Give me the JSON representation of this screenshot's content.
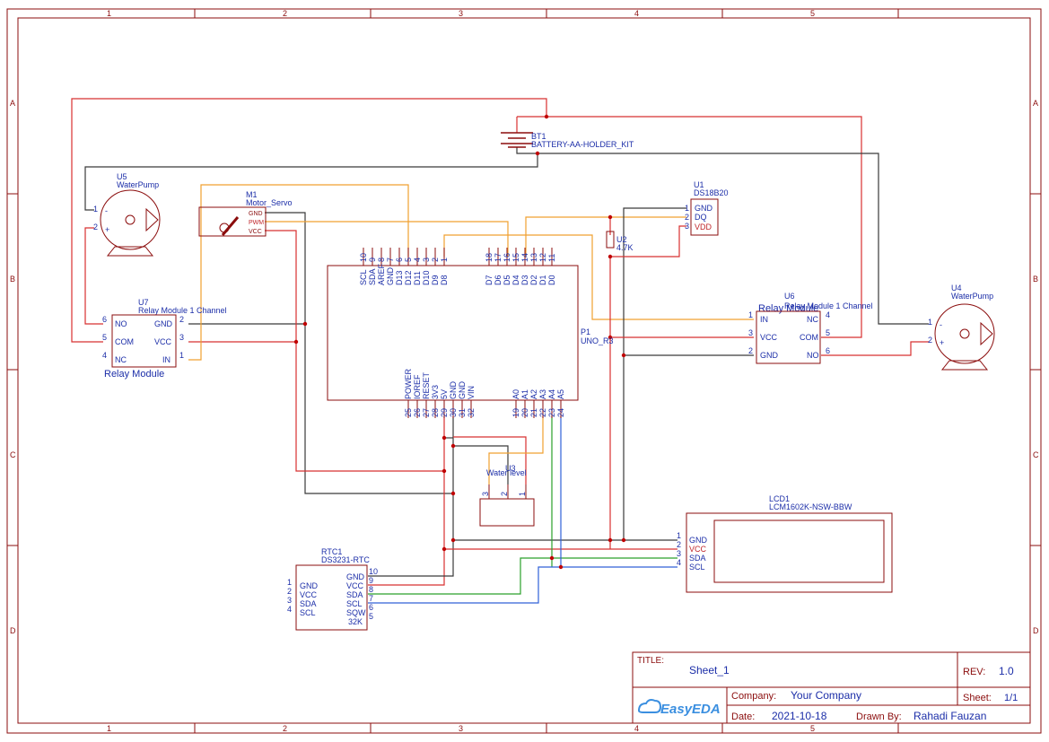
{
  "frame": {
    "col_numbers": [
      "1",
      "2",
      "3",
      "4",
      "5"
    ],
    "row_letters": [
      "A",
      "B",
      "C",
      "D"
    ]
  },
  "title_block": {
    "title_label": "TITLE:",
    "title_value": "Sheet_1",
    "rev_label": "REV:",
    "rev_value": "1.0",
    "company_label": "Company:",
    "company_value": "Your Company",
    "sheet_label": "Sheet:",
    "sheet_value": "1/1",
    "date_label": "Date:",
    "date_value": "2021-10-18",
    "drawn_label": "Drawn By:",
    "drawn_value": "Rahadi Fauzan",
    "logo_text": "EasyEDA"
  },
  "components": {
    "bt1": {
      "ref": "BT1",
      "name": "BATTERY-AA-HOLDER_KIT"
    },
    "u5": {
      "ref": "U5",
      "name": "WaterPump",
      "pin1": "1",
      "pin2": "2",
      "minus": "-",
      "plus": "+"
    },
    "u4": {
      "ref": "U4",
      "name": "WaterPump",
      "pin1": "1",
      "pin2": "2",
      "minus": "-",
      "plus": "+"
    },
    "m1": {
      "ref": "M1",
      "name": "Motor_Servo",
      "gnd": "GND",
      "pwm": "PWM",
      "vcc": "VCC"
    },
    "u1": {
      "ref": "U1",
      "name": "DS18B20",
      "pins": [
        {
          "num": "1",
          "label": "GND"
        },
        {
          "num": "2",
          "label": "DQ"
        },
        {
          "num": "3",
          "label": "VDD"
        }
      ]
    },
    "u2": {
      "ref": "U2",
      "value": "4.7K"
    },
    "u7": {
      "ref": "U7",
      "name": "Relay Module 1 Channel",
      "caption": "Relay Module",
      "left": [
        {
          "num": "6",
          "label": "NO"
        },
        {
          "num": "5",
          "label": "COM"
        },
        {
          "num": "4",
          "label": "NC"
        }
      ],
      "right": [
        {
          "num": "2",
          "label": "GND"
        },
        {
          "num": "3",
          "label": "VCC"
        },
        {
          "num": "1",
          "label": "IN"
        }
      ]
    },
    "u6": {
      "ref": "U6",
      "name": "Relay Module 1 Channel",
      "caption": "Relay Module",
      "left": [
        {
          "num": "1",
          "label": "IN"
        },
        {
          "num": "3",
          "label": "VCC"
        },
        {
          "num": "2",
          "label": "GND"
        }
      ],
      "right": [
        {
          "num": "4",
          "label": "NC"
        },
        {
          "num": "5",
          "label": "COM"
        },
        {
          "num": "6",
          "label": "NO"
        }
      ]
    },
    "p1": {
      "ref": "P1",
      "name": "UNO_R3",
      "top_left": [
        {
          "num": "10",
          "label": "SCL"
        },
        {
          "num": "9",
          "label": "SDA"
        },
        {
          "num": "8",
          "label": "AREF"
        },
        {
          "num": "7",
          "label": "GND"
        },
        {
          "num": "6",
          "label": "D13"
        },
        {
          "num": "5",
          "label": "D12"
        },
        {
          "num": "4",
          "label": "D11"
        },
        {
          "num": "3",
          "label": "D10"
        },
        {
          "num": "2",
          "label": "D9"
        },
        {
          "num": "1",
          "label": "D8"
        }
      ],
      "top_right": [
        {
          "num": "18",
          "label": "D7"
        },
        {
          "num": "17",
          "label": "D6"
        },
        {
          "num": "16",
          "label": "D5"
        },
        {
          "num": "15",
          "label": "D4"
        },
        {
          "num": "14",
          "label": "D3"
        },
        {
          "num": "13",
          "label": "D2"
        },
        {
          "num": "12",
          "label": "D1"
        },
        {
          "num": "11",
          "label": "D0"
        }
      ],
      "bottom_left": [
        {
          "num": "25",
          "label": "POWER"
        },
        {
          "num": "26",
          "label": "IOREF"
        },
        {
          "num": "27",
          "label": "RESET"
        },
        {
          "num": "28",
          "label": "3V3"
        },
        {
          "num": "29",
          "label": "5V"
        },
        {
          "num": "30",
          "label": "GND"
        },
        {
          "num": "31",
          "label": "GND"
        },
        {
          "num": "32",
          "label": "VIN"
        }
      ],
      "bottom_right": [
        {
          "num": "19",
          "label": "A0"
        },
        {
          "num": "20",
          "label": "A1"
        },
        {
          "num": "21",
          "label": "A2"
        },
        {
          "num": "22",
          "label": "A3"
        },
        {
          "num": "23",
          "label": "A4"
        },
        {
          "num": "24",
          "label": "A5"
        }
      ]
    },
    "u3": {
      "ref": "U3",
      "name": "Water level",
      "pins": [
        "3",
        "2",
        "1"
      ]
    },
    "lcd1": {
      "ref": "LCD1",
      "name": "LCM1602K-NSW-BBW",
      "pins": [
        {
          "num": "1",
          "label": "GND"
        },
        {
          "num": "2",
          "label": "VCC"
        },
        {
          "num": "3",
          "label": "SDA"
        },
        {
          "num": "4",
          "label": "SCL"
        }
      ]
    },
    "rtc1": {
      "ref": "RTC1",
      "name": "DS3231-RTC",
      "left": [
        {
          "num": "1",
          "label": "GND"
        },
        {
          "num": "2",
          "label": "VCC"
        },
        {
          "num": "3",
          "label": "SDA"
        },
        {
          "num": "4",
          "label": "SCL"
        }
      ],
      "right": [
        {
          "num": "10",
          "label": "GND"
        },
        {
          "num": "9",
          "label": "VCC"
        },
        {
          "num": "8",
          "label": "SDA"
        },
        {
          "num": "7",
          "label": "SCL"
        },
        {
          "num": "6",
          "label": "SQW"
        },
        {
          "num": "5",
          "label": "32K"
        }
      ]
    }
  },
  "colors": {
    "frame": "#8b0d0d",
    "power_wire": "#d83030",
    "ground_wire": "#3a3a3a",
    "signal_wire": "#f0a030",
    "sda_wire": "#2aa02a",
    "scl_wire": "#3060d8",
    "label": "#1c2ea8"
  }
}
